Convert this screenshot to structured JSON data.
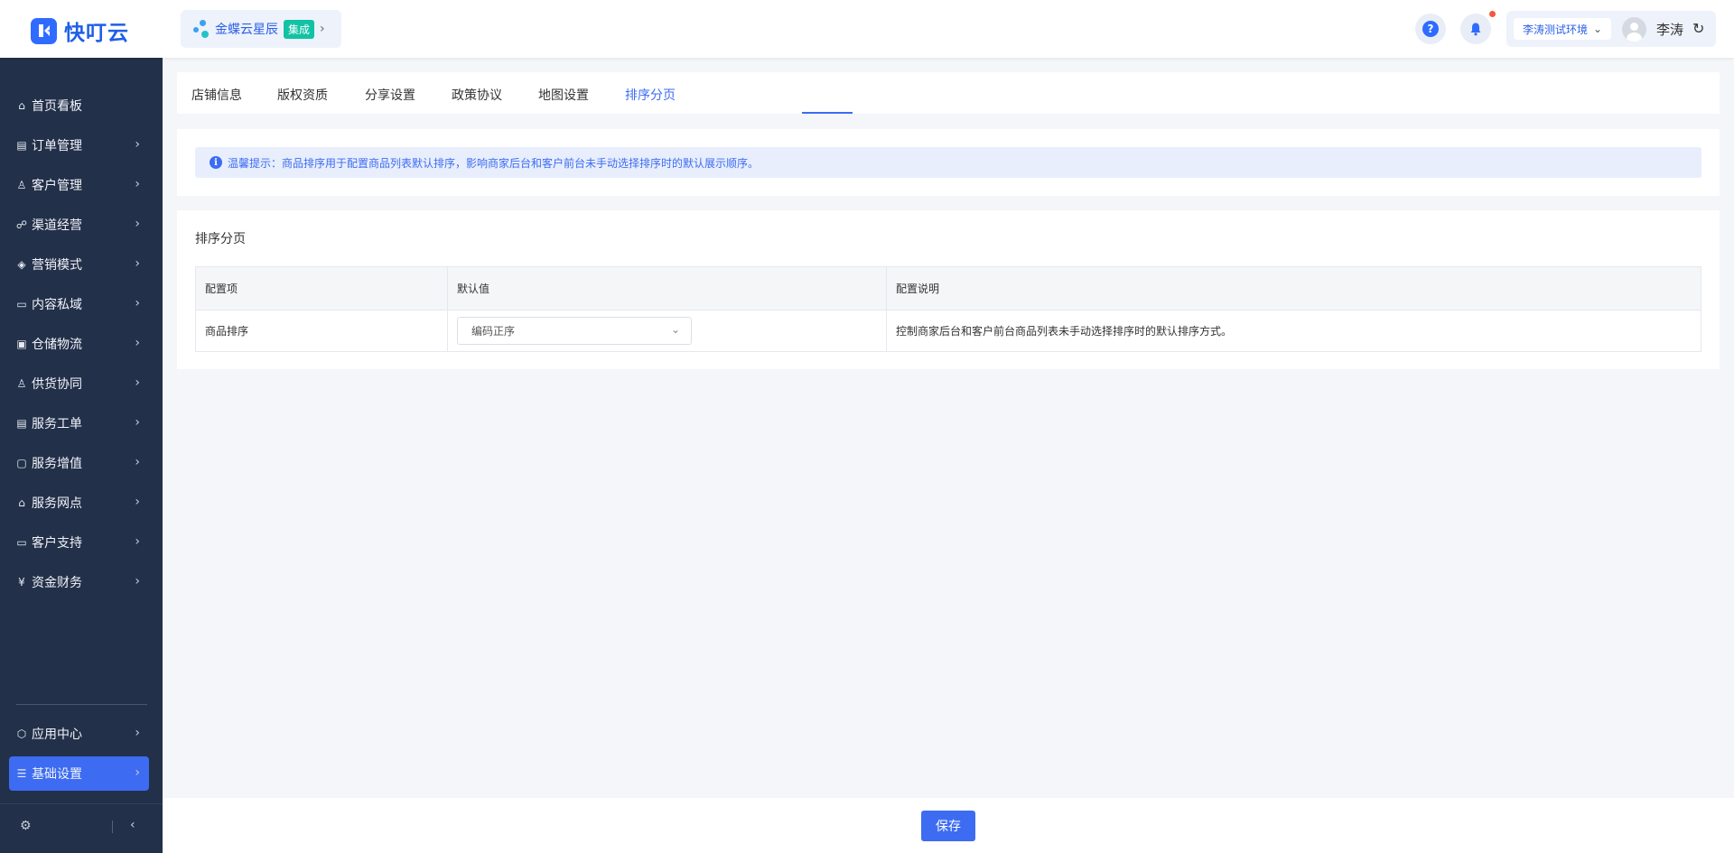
{
  "brand": {
    "name": "快叮云",
    "accent": "#2f6bff"
  },
  "org": {
    "name": "金蝶云星辰",
    "badge": "集成"
  },
  "header": {
    "env": "李涛测试环境",
    "user": "李涛"
  },
  "sidebar": {
    "items": [
      {
        "label": "首页看板",
        "icon": "home-icon"
      },
      {
        "label": "订单管理",
        "icon": "clipboard-icon"
      },
      {
        "label": "客户管理",
        "icon": "user-icon"
      },
      {
        "label": "渠道经营",
        "icon": "channel-icon"
      },
      {
        "label": "营销模式",
        "icon": "tag-icon"
      },
      {
        "label": "内容私域",
        "icon": "image-icon"
      },
      {
        "label": "仓储物流",
        "icon": "box-icon"
      },
      {
        "label": "供货协同",
        "icon": "supply-icon"
      },
      {
        "label": "服务工单",
        "icon": "ticket-icon"
      },
      {
        "label": "服务增值",
        "icon": "bag-icon"
      },
      {
        "label": "服务网点",
        "icon": "store-icon"
      },
      {
        "label": "客户支持",
        "icon": "support-icon"
      },
      {
        "label": "资金财务",
        "icon": "yuan-icon"
      }
    ],
    "bottom_items": [
      {
        "label": "应用中心",
        "icon": "cube-icon"
      },
      {
        "label": "基础设置",
        "icon": "settings-sliders-icon",
        "active": true
      }
    ]
  },
  "tabs": [
    "店铺信息",
    "版权资质",
    "分享设置",
    "政策协议",
    "地图设置",
    "排序分页"
  ],
  "active_tab": "排序分页",
  "tip": {
    "text": "温馨提示：商品排序用于配置商品列表默认排序，影响商家后台和客户前台未手动选择排序时的默认展示顺序。"
  },
  "section": {
    "title": "排序分页"
  },
  "table": {
    "headers": [
      "配置项",
      "默认值",
      "配置说明"
    ],
    "rows": [
      {
        "item": "商品排序",
        "value": "编码正序",
        "desc": "控制商家后台和客户前台商品列表未手动选择排序时的默认排序方式。"
      }
    ]
  },
  "footer": {
    "save_label": "保存"
  }
}
